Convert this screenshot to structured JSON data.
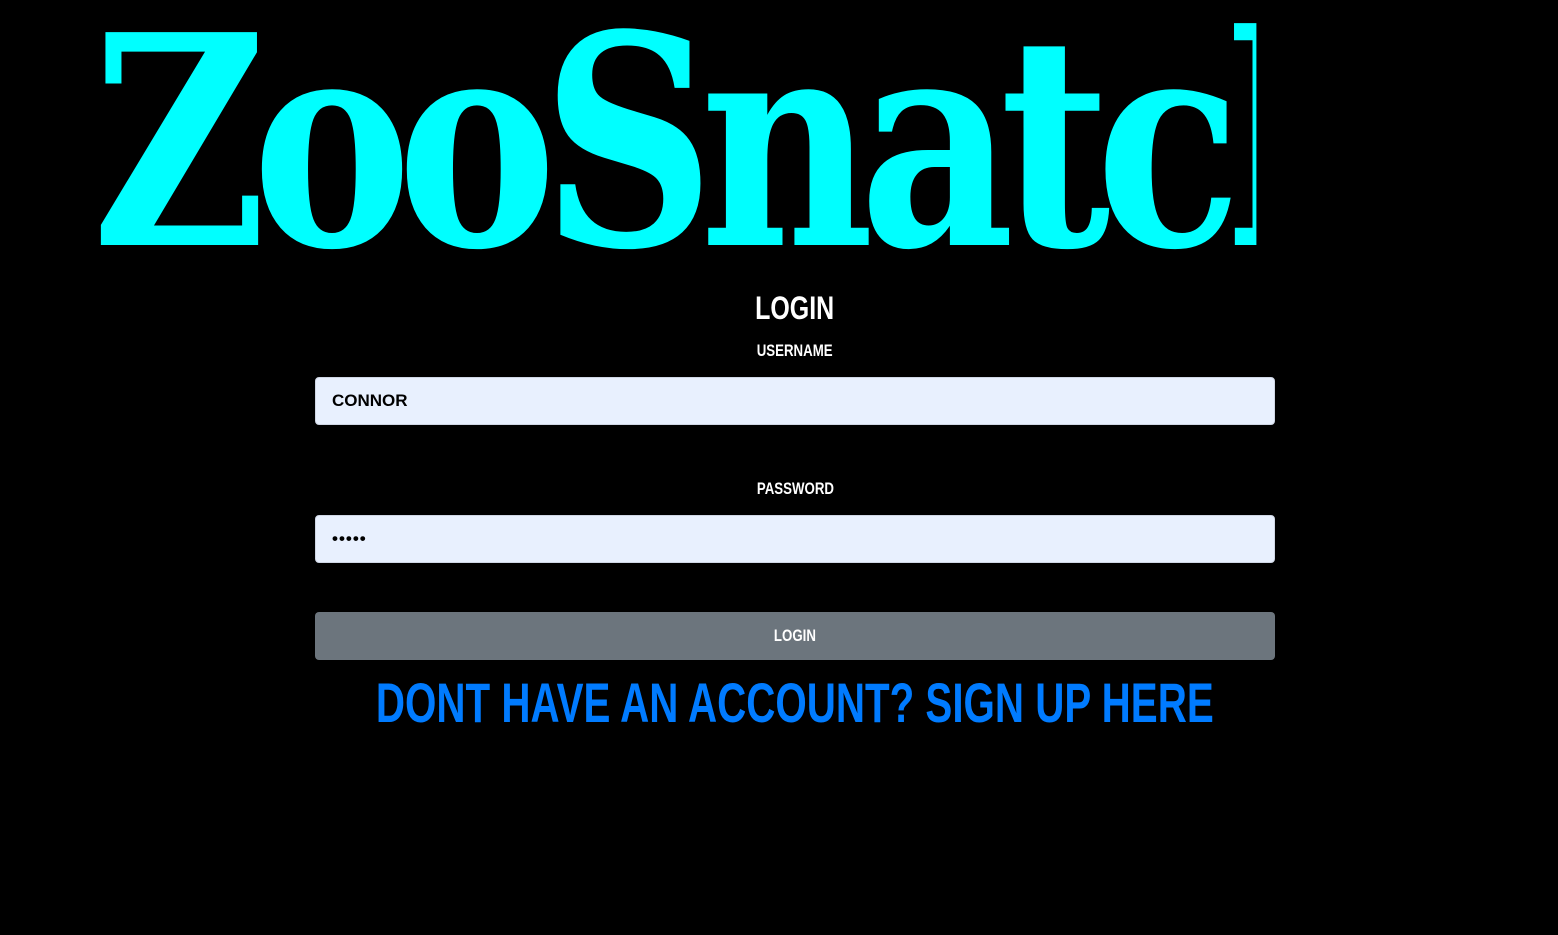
{
  "brand": {
    "title": "ZooSnatch",
    "color": "#00ffff"
  },
  "login_form": {
    "heading": "LOGIN",
    "username": {
      "label": "USERNAME",
      "value": "CONNOR"
    },
    "password": {
      "label": "PASSWORD",
      "value": "•••••"
    },
    "submit_label": "LOGIN",
    "signup_link_text": "DONT HAVE AN ACCOUNT? SIGN UP HERE"
  },
  "colors": {
    "background": "#000000",
    "input_background": "#e8f0fe",
    "button_background": "#6c757d",
    "link": "#007bff",
    "text": "#ffffff"
  }
}
